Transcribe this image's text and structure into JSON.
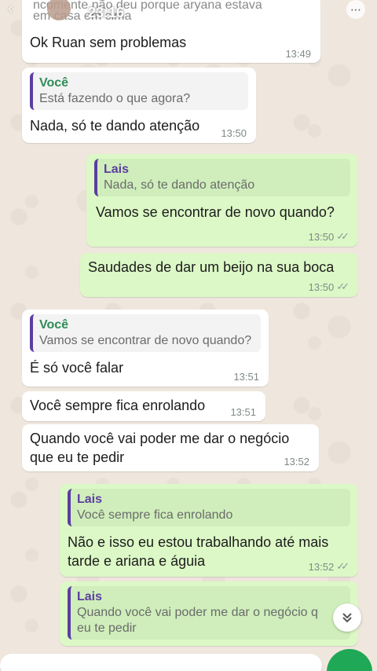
{
  "status": {
    "time": "23:16"
  },
  "top_partial": {
    "quote_line1": "ncomente não deu porque aryana estava",
    "quote_line2": "em casa em cima",
    "text": "Ok Ruan sem problemas",
    "time": "13:49"
  },
  "messages": [
    {
      "quote_name": "Você",
      "quote_text": "Está fazendo o que agora?",
      "text": "Nada, só te dando atenção",
      "time": "13:50"
    },
    {
      "quote_name": "Lais",
      "quote_text": "Nada, só te dando atenção",
      "text": "Vamos se encontrar de novo quando?",
      "time": "13:50",
      "ticks": "✓✓"
    },
    {
      "text": "Saudades de dar um beijo na sua boca",
      "time": "13:50",
      "ticks": "✓✓"
    },
    {
      "quote_name": "Você",
      "quote_text": "Vamos se encontrar de novo quando?",
      "text": "É só você falar",
      "time": "13:51"
    },
    {
      "text": "Você sempre fica enrolando",
      "time": "13:51"
    },
    {
      "text_line1": "Quando você vai poder me dar o negócio",
      "text_line2": "que eu te pedir",
      "time": "13:52"
    },
    {
      "quote_name": "Lais",
      "quote_text": "Você sempre fica enrolando",
      "text_line1": "Não e isso eu estou trabalhando até mais",
      "text_line2": "tarde e ariana e águia",
      "time": "13:52",
      "ticks": "✓✓"
    },
    {
      "quote_name": "Lais",
      "quote_text_line1": "Quando você vai poder me dar o negócio qu",
      "quote_text_line2": "eu te pedir"
    }
  ],
  "icons": {
    "back": "back-arrow-icon",
    "more": "more-options-icon",
    "scroll_down": "double-chevron-down-icon",
    "mic": "mic-icon"
  },
  "colors": {
    "incoming": "#ffffff",
    "outgoing": "#dcf8c6",
    "quote_bar": "#5b3ea0",
    "accent_green": "#1fa855"
  }
}
